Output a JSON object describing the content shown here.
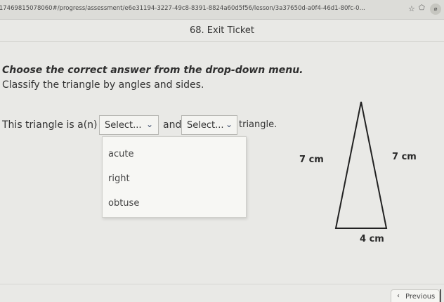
{
  "browser": {
    "url": "/17469815078060#/progress/assessment/e6e31194-3227-49c8-8391-8824a60d5f56/lesson/3a37650d-a0f4-46d1-80fc-0...",
    "star_glyph": "☆",
    "ext_glyph": "⬠",
    "profile_glyph": "⌀"
  },
  "page": {
    "title": "68. Exit Ticket"
  },
  "question": {
    "instructions": "Choose the correct answer from the drop-down menu.",
    "prompt": "Classify the triangle by angles and sides.",
    "sentence_start": "This triangle is a(n)",
    "sentence_and": "and",
    "sentence_end": "triangle."
  },
  "selects": [
    {
      "label": "Select...",
      "chevron": "⌄"
    },
    {
      "label": "Select...",
      "chevron": "⌄"
    }
  ],
  "dropdown": {
    "options": [
      "acute",
      "right",
      "obtuse"
    ]
  },
  "figure": {
    "left_side": "7 cm",
    "right_side": "7 cm",
    "base": "4 cm"
  },
  "navigation": {
    "previous_label": "Previous",
    "previous_glyph": "‹"
  }
}
